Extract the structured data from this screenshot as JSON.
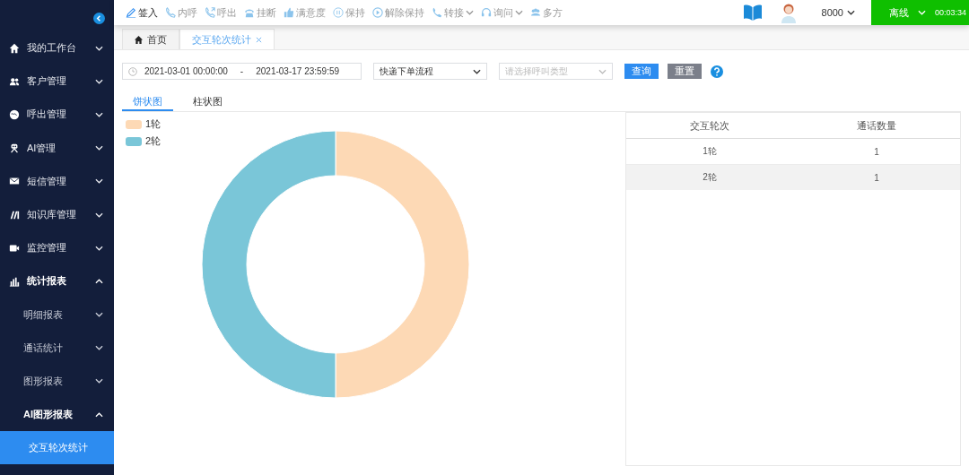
{
  "sidebar": {
    "items": [
      {
        "label": "我的工作台",
        "expanded": false,
        "selected": false
      },
      {
        "label": "客户管理",
        "expanded": false,
        "selected": false
      },
      {
        "label": "呼出管理",
        "expanded": false,
        "selected": false
      },
      {
        "label": "AI管理",
        "expanded": false,
        "selected": false
      },
      {
        "label": "短信管理",
        "expanded": false,
        "selected": false
      },
      {
        "label": "知识库管理",
        "expanded": false,
        "selected": false
      },
      {
        "label": "监控管理",
        "expanded": false,
        "selected": false
      },
      {
        "label": "统计报表",
        "expanded": true,
        "selected": false,
        "children": [
          {
            "label": "明细报表",
            "expanded": false,
            "selected": false
          },
          {
            "label": "通话统计",
            "expanded": false,
            "selected": false
          },
          {
            "label": "图形报表",
            "expanded": false,
            "selected": false
          },
          {
            "label": "AI图形报表",
            "expanded": true,
            "selected": false,
            "children": [
              {
                "label": "交互轮次统计",
                "selected": true
              }
            ]
          }
        ]
      }
    ]
  },
  "toolbar": [
    {
      "label": "签入",
      "disabled": false,
      "dropdown": false
    },
    {
      "label": "内呼",
      "disabled": true,
      "dropdown": false
    },
    {
      "label": "呼出",
      "disabled": true,
      "dropdown": false
    },
    {
      "label": "挂断",
      "disabled": true,
      "dropdown": false
    },
    {
      "label": "满意度",
      "disabled": true,
      "dropdown": false
    },
    {
      "label": "保持",
      "disabled": true,
      "dropdown": false
    },
    {
      "label": "解除保持",
      "disabled": true,
      "dropdown": false
    },
    {
      "label": "转接",
      "disabled": true,
      "dropdown": true
    },
    {
      "label": "询问",
      "disabled": true,
      "dropdown": true
    },
    {
      "label": "多方",
      "disabled": true,
      "dropdown": false
    }
  ],
  "user": {
    "extension": "8000",
    "status": "离线",
    "timer": "00:03:34"
  },
  "tabs": [
    {
      "label": "首页",
      "selected": false,
      "closable": false
    },
    {
      "label": "交互轮次统计",
      "selected": true,
      "closable": true
    }
  ],
  "filters": {
    "date_start": "2021-03-01 00:00:00",
    "date_separator": "-",
    "date_end": "2021-03-17 23:59:59",
    "flow": "快递下单流程",
    "call_type_placeholder": "请选择呼叫类型",
    "query": "查询",
    "reset": "重置"
  },
  "chart_tabs": [
    {
      "label": "饼状图",
      "selected": true
    },
    {
      "label": "柱状图",
      "selected": false
    }
  ],
  "chart": {
    "legend": [
      {
        "color": "#fdd9b5"
      },
      {
        "color": "#7ac6d8"
      }
    ],
    "chart_data": {
      "type": "donut",
      "categories": [
        "1轮",
        "2轮"
      ],
      "values": [
        1,
        1
      ]
    }
  },
  "table": {
    "columns": [
      "交互轮次",
      "通话数量"
    ],
    "rows": [
      [
        "1轮",
        "1"
      ],
      [
        "2轮",
        "1"
      ]
    ]
  }
}
